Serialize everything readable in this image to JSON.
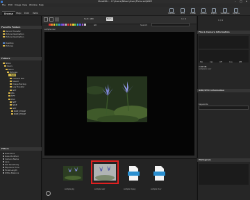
{
  "window": {
    "title": "ViewNX-i - C:\\Users\\Nikon\\User\\Pictures\\NIKE"
  },
  "menu": [
    "File",
    "Edit",
    "Image",
    "View",
    "Window",
    "Help"
  ],
  "modes": [
    "Browse",
    "Map",
    "Edit",
    "Web"
  ],
  "toolbar": [
    {
      "label": "Transfer",
      "icon": "transfer-icon"
    },
    {
      "label": "Print",
      "icon": "print-icon"
    },
    {
      "label": "E-Mail",
      "icon": "email-icon"
    },
    {
      "label": "Upload",
      "icon": "upload-icon"
    },
    {
      "label": "Export",
      "icon": "export-icon"
    },
    {
      "label": "Slideshow",
      "icon": "slideshow-icon"
    },
    {
      "label": "Options",
      "icon": "options-icon"
    }
  ],
  "left": {
    "favorites": {
      "title": "Favorite Folders",
      "items": [
        "Recent Transfer",
        "Picture Destination",
        "Picture Destination"
      ]
    },
    "shortcuts": {
      "items": [
        "Desktop",
        "Pictures"
      ]
    },
    "folders": {
      "title": "Folders",
      "items": [
        "Nikon",
        "Users",
        "Nikon",
        "Pictures",
        "NIKE",
        "Camera Roll",
        "Saved",
        "Image Backup",
        "Log Transfer",
        "NEF",
        "JPG",
        "TIFF",
        "DSC",
        "NEF",
        "NIKE",
        "NEF",
        "NIKE_PHASE",
        "NIKE_PHASE"
      ],
      "selected": "NIKE"
    },
    "filters": {
      "title": "Filters",
      "items": [
        "Date Shot",
        "Date Modified",
        "Camera Name",
        "Lens",
        "ISO Sensitivity",
        "Exposure Time",
        "Focal Length",
        "White Balance"
      ]
    }
  },
  "content": {
    "sort": "Sort: ABC",
    "all": "All",
    "sort2": "Name",
    "search": "Search",
    "page": "1 / 4",
    "file": "sample.nesr"
  },
  "filmstrip": {
    "items": [
      {
        "name": "sample.jpg",
        "selected": false
      },
      {
        "name": "sample.nesr",
        "selected": true
      },
      {
        "name": "sample.mpeg",
        "selected": false
      },
      {
        "name": "sample.mov",
        "selected": false
      }
    ]
  },
  "right": {
    "page": "1 / 4",
    "sections": [
      "File & Camera Information",
      "XMP/IPTC Information",
      "Histogram"
    ],
    "keywords": "Keywords",
    "labels": [
      "Nik",
      "Can",
      "Off",
      "Cus",
      "WB"
    ],
    "filesize": "2.86 MB",
    "sub": "samplexx.nesr"
  },
  "colors": {
    "accent": "#e02020",
    "folder": "#d9b64a",
    "selected": "#c9b64a"
  }
}
